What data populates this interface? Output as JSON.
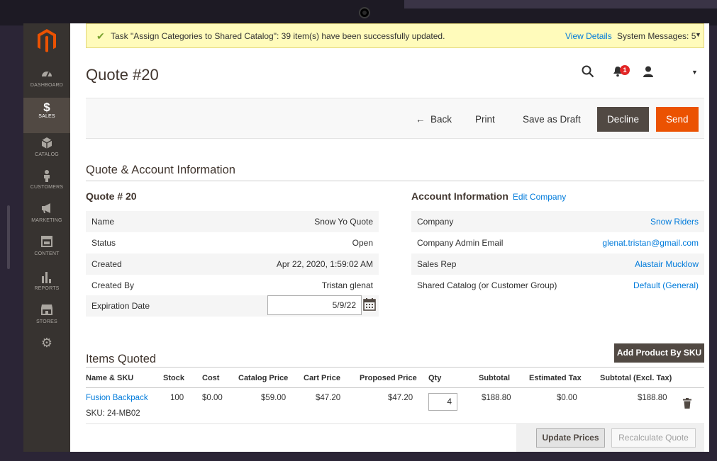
{
  "message_bar": {
    "text": "Task \"Assign Categories to Shared Catalog\": 39 item(s) have been successfully updated.",
    "view_details": "View Details",
    "system_messages": "System Messages: 5"
  },
  "sidebar": {
    "items": [
      {
        "label": "DASHBOARD",
        "icon": "dashboard-icon"
      },
      {
        "label": "SALES",
        "icon": "dollar-icon"
      },
      {
        "label": "CATALOG",
        "icon": "box-icon"
      },
      {
        "label": "CUSTOMERS",
        "icon": "person-icon"
      },
      {
        "label": "MARKETING",
        "icon": "megaphone-icon"
      },
      {
        "label": "CONTENT",
        "icon": "layout-icon"
      },
      {
        "label": "REPORTS",
        "icon": "bar-chart-icon"
      },
      {
        "label": "STORES",
        "icon": "storefront-icon"
      },
      {
        "label": "",
        "icon": "gear-icon"
      }
    ],
    "active_index": 1
  },
  "header": {
    "title": "Quote #20",
    "notification_count": "1"
  },
  "actions": {
    "back": "Back",
    "print": "Print",
    "save_draft": "Save as Draft",
    "decline": "Decline",
    "send": "Send"
  },
  "info_section": {
    "title": "Quote & Account Information",
    "quote": {
      "title": "Quote # 20",
      "rows": [
        {
          "label": "Name",
          "value": "Snow Yo Quote"
        },
        {
          "label": "Status",
          "value": "Open"
        },
        {
          "label": "Created",
          "value": "Apr 22, 2020, 1:59:02 AM"
        },
        {
          "label": "Created By",
          "value": "Tristan glenat"
        },
        {
          "label": "Expiration Date",
          "value": "5/9/22"
        }
      ]
    },
    "account": {
      "title": "Account Information",
      "edit_link": "Edit Company",
      "rows": [
        {
          "label": "Company",
          "value": "Snow Riders"
        },
        {
          "label": "Company Admin Email",
          "value": "glenat.tristan@gmail.com"
        },
        {
          "label": "Sales Rep",
          "value": "Alastair Mucklow"
        },
        {
          "label": "Shared Catalog (or Customer Group)",
          "value": "Default (General)"
        }
      ]
    }
  },
  "items": {
    "title": "Items Quoted",
    "add_button": "Add Product By SKU",
    "columns": [
      "Name & SKU",
      "Stock",
      "Cost",
      "Catalog Price",
      "Cart Price",
      "Proposed Price",
      "Qty",
      "Subtotal",
      "Estimated Tax",
      "Subtotal (Excl. Tax)"
    ],
    "rows": [
      {
        "name": "Fusion Backpack",
        "sku": "SKU: 24-MB02",
        "stock": "100",
        "cost": "$0.00",
        "catalog_price": "$59.00",
        "cart_price": "$47.20",
        "proposed_price": "$47.20",
        "qty": "4",
        "subtotal": "$188.80",
        "estimated_tax": "$0.00",
        "subtotal_excl_tax": "$188.80"
      }
    ],
    "update_prices": "Update Prices",
    "recalculate": "Recalculate Quote"
  }
}
